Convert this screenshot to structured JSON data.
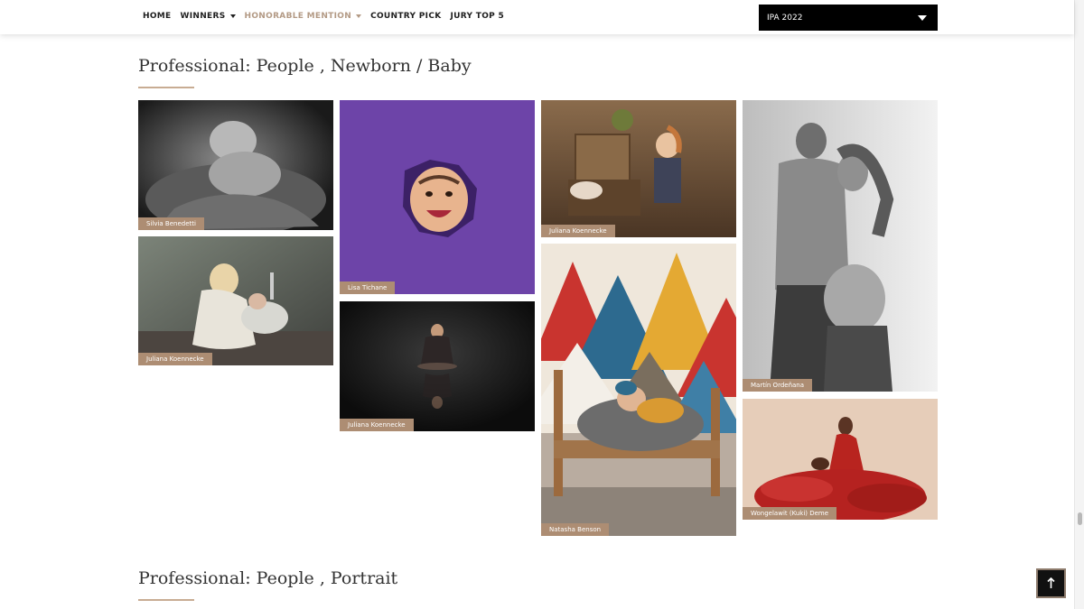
{
  "nav": {
    "items": [
      {
        "label": "HOME",
        "dropdown": false,
        "active": false
      },
      {
        "label": "WINNERS",
        "dropdown": true,
        "active": false
      },
      {
        "label": "HONORABLE MENTION",
        "dropdown": true,
        "active": true
      },
      {
        "label": "COUNTRY PICK",
        "dropdown": false,
        "active": false
      },
      {
        "label": "JURY TOP 5",
        "dropdown": false,
        "active": false
      }
    ],
    "year_select": "IPA 2022"
  },
  "colors": {
    "accent": "#b39a85",
    "caption_bg": "#ad8d73",
    "underline": "#c8ac93"
  },
  "sections": [
    {
      "title": "Professional: People , Newborn / Baby",
      "photos": [
        {
          "credit": "Silvia Benedetti",
          "kind": "bw-newborn-hands"
        },
        {
          "credit": "Juliana Koennecke",
          "kind": "girl-with-baby-in-bucket"
        },
        {
          "credit": "Lisa Tichane",
          "kind": "baby-through-purple-paper"
        },
        {
          "credit": "Juliana Koennecke",
          "kind": "dark-figure-reflection"
        },
        {
          "credit": "Juliana Koennecke",
          "kind": "girl-with-newborn-crate"
        },
        {
          "credit": "Natasha Benson",
          "kind": "newborn-on-bench-mountains"
        },
        {
          "credit": "Martín Ordeñana",
          "kind": "bw-maternity-couple"
        },
        {
          "credit": "Wongelawit (Kuki) Deme",
          "kind": "red-dress-maternity"
        }
      ]
    },
    {
      "title": "Professional: People , Portrait",
      "photos": []
    }
  ]
}
